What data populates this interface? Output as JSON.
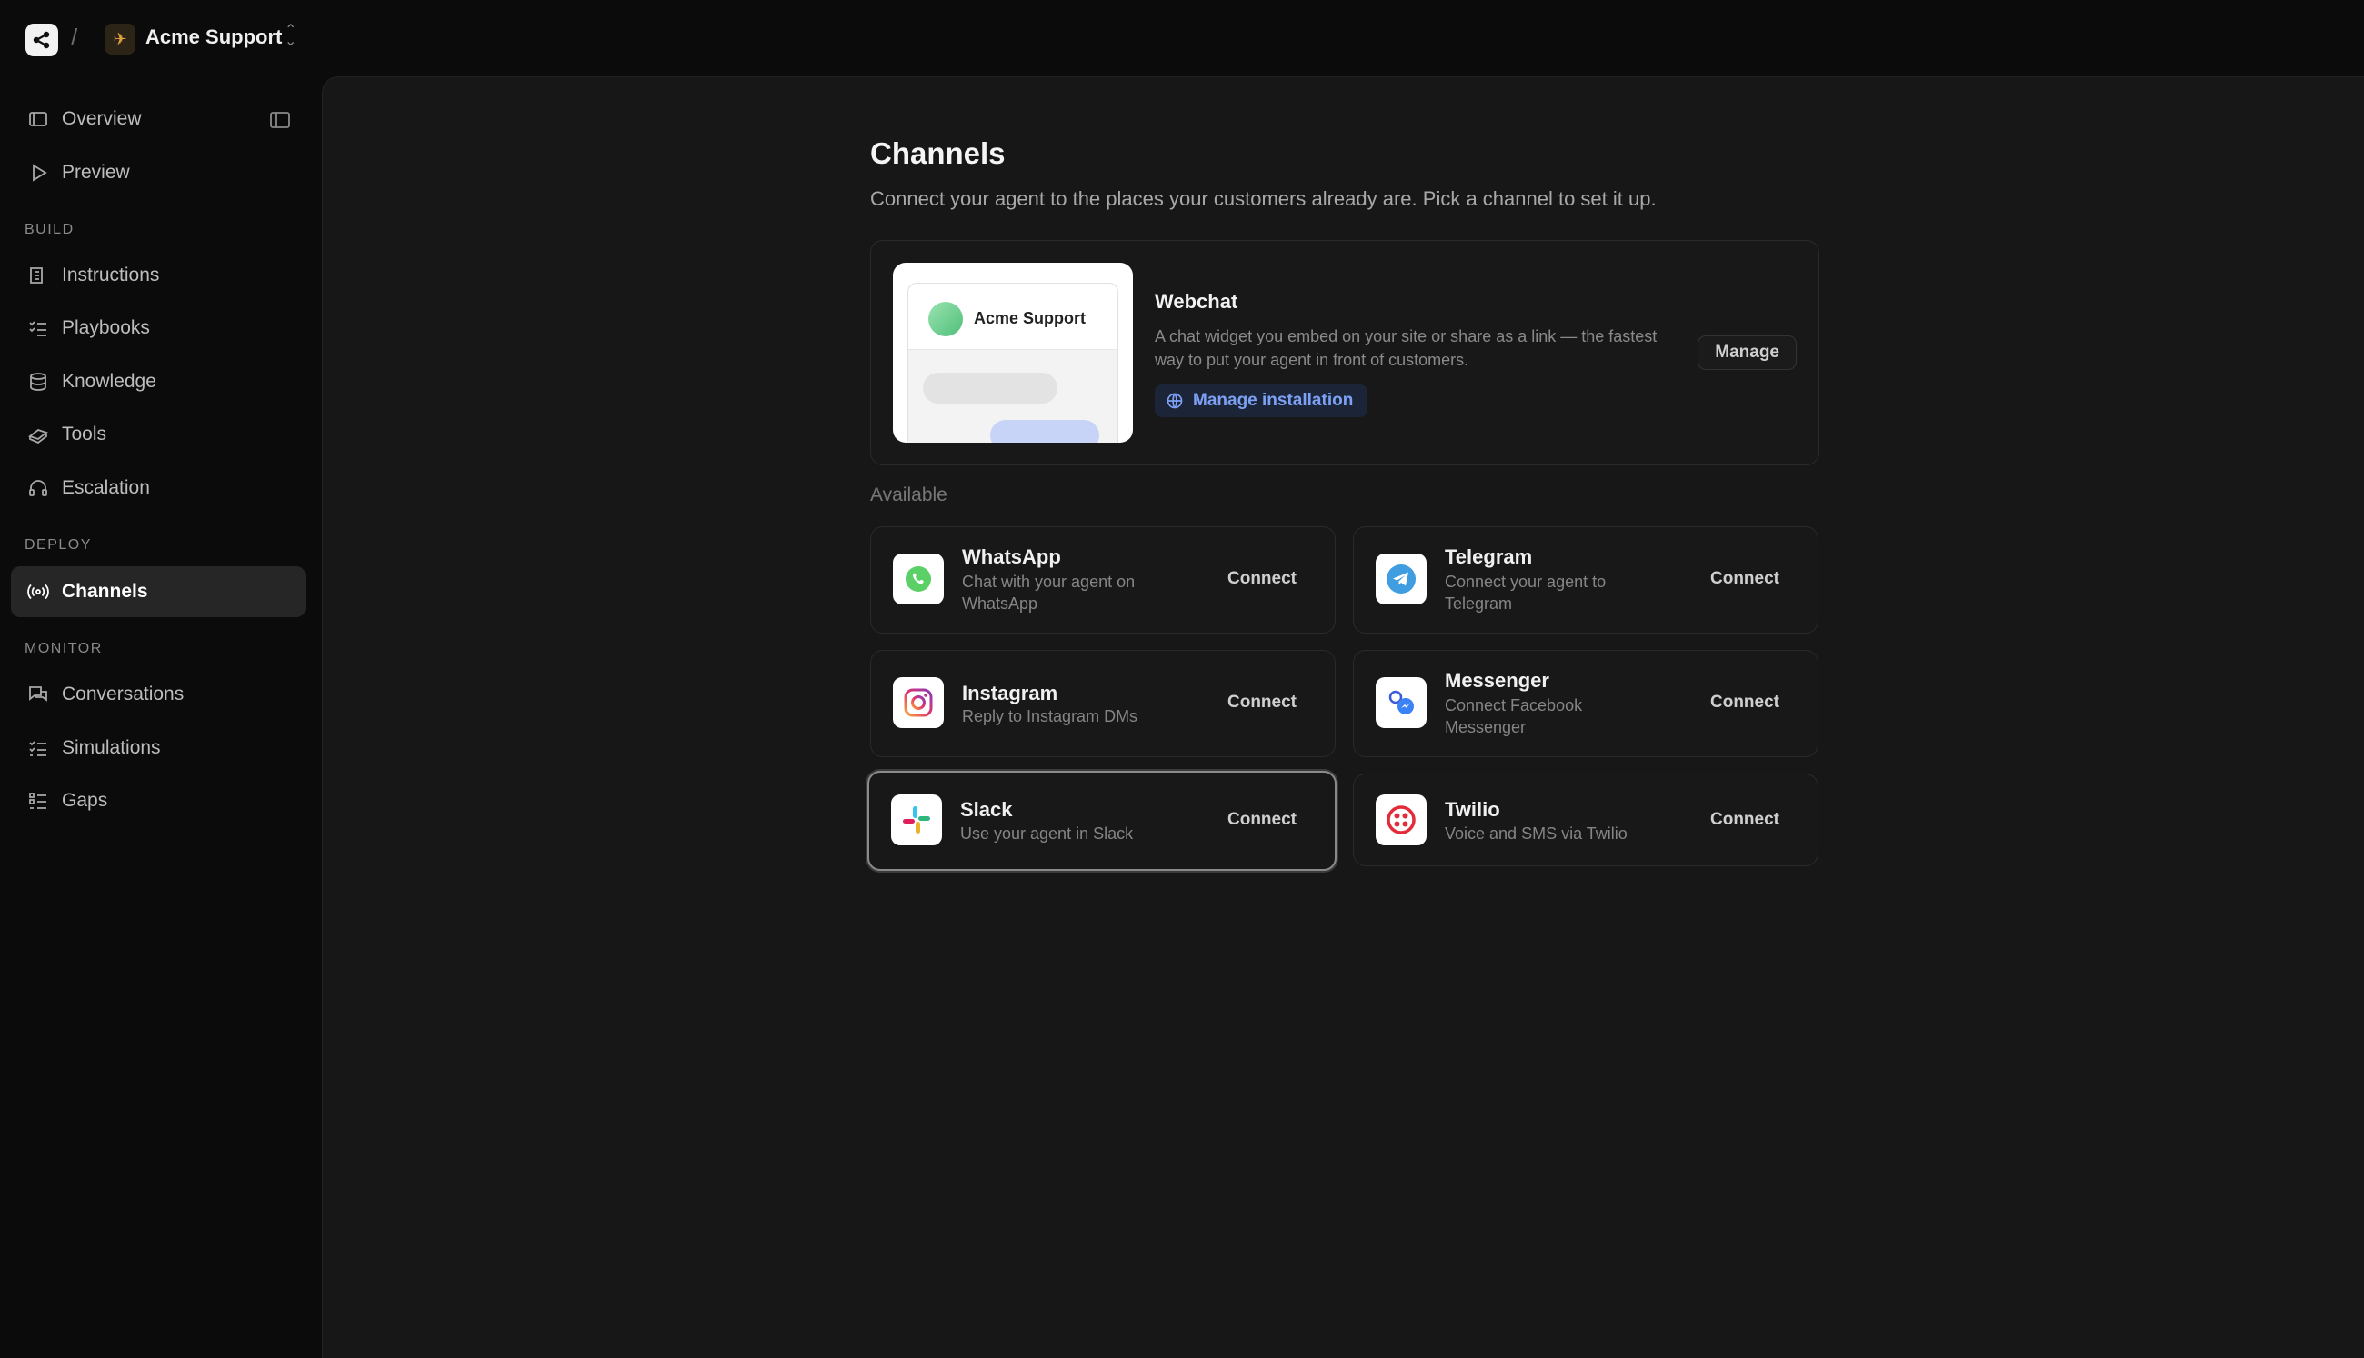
{
  "topbar": {
    "workspace_name": "Acme Support",
    "separator": "/"
  },
  "sidebar": {
    "items_top": [
      {
        "label": "Overview",
        "icon": "overview-icon"
      },
      {
        "label": "Preview",
        "icon": "play-icon"
      }
    ],
    "sections": {
      "build": "BUILD",
      "deploy": "DEPLOY",
      "monitor": "MONITOR"
    },
    "build_items": [
      {
        "label": "Instructions",
        "icon": "instructions-icon"
      },
      {
        "label": "Playbooks",
        "icon": "playbooks-icon"
      },
      {
        "label": "Knowledge",
        "icon": "database-icon"
      },
      {
        "label": "Tools",
        "icon": "tools-icon"
      },
      {
        "label": "Escalation",
        "icon": "headset-icon"
      }
    ],
    "deploy_items": [
      {
        "label": "Channels",
        "icon": "broadcast-icon",
        "active": true
      }
    ],
    "monitor_items": [
      {
        "label": "Conversations",
        "icon": "chat-icon"
      },
      {
        "label": "Simulations",
        "icon": "list-check-icon"
      },
      {
        "label": "Gaps",
        "icon": "list-icon"
      }
    ]
  },
  "main": {
    "title": "Channels",
    "subtitle": "Connect your agent to the places your customers already are. Pick a channel to set it up.",
    "webchat": {
      "preview_name": "Acme Support",
      "title": "Webchat",
      "description": "A chat widget you embed on your site or share as a link — the fastest way to put your agent in front of customers.",
      "link_label": "Manage installation",
      "manage_label": "Manage"
    },
    "available_label": "Available",
    "channels": [
      {
        "name": "WhatsApp",
        "description": "Chat with your agent on WhatsApp",
        "button": "Connect"
      },
      {
        "name": "Telegram",
        "description": "Connect your agent to Telegram",
        "button": "Connect"
      },
      {
        "name": "Instagram",
        "description": "Reply to Instagram DMs",
        "button": "Connect"
      },
      {
        "name": "Messenger",
        "description": "Connect Facebook Messenger",
        "button": "Connect"
      },
      {
        "name": "Slack",
        "description": "Use your agent in Slack",
        "button": "Connect"
      },
      {
        "name": "Twilio",
        "description": "Voice and SMS via Twilio",
        "button": "Connect"
      }
    ]
  },
  "colors": {
    "accent_link": "#7da2f5",
    "background": "#0b0b0b",
    "panel": "#171717"
  }
}
